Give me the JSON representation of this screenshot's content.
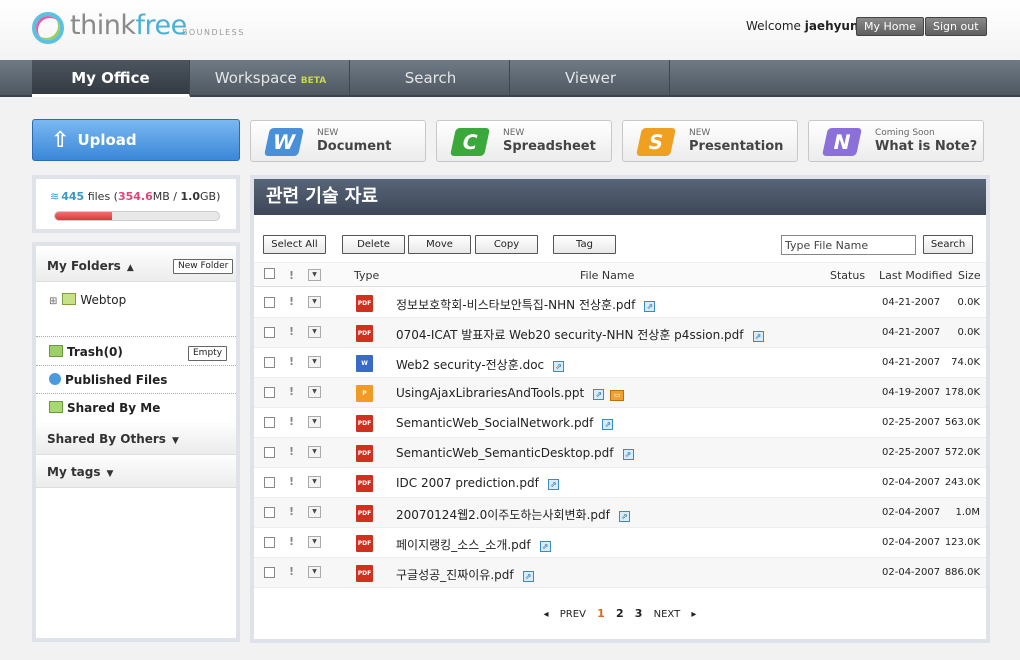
{
  "app": {
    "logo_think": "think",
    "logo_free": "free",
    "logo_tagline": "BOUNDLESS"
  },
  "header": {
    "welcome": "Welcome",
    "username": "jaehyun",
    "my_home": "My Home",
    "sign_out": "Sign out"
  },
  "nav": {
    "tabs": [
      {
        "label": "My Office",
        "active": true
      },
      {
        "label": "Workspace",
        "badge": "BETA"
      },
      {
        "label": "Search"
      },
      {
        "label": "Viewer"
      }
    ]
  },
  "actions": {
    "upload": "Upload",
    "new": [
      {
        "small": "NEW",
        "big": "Document",
        "color": "#4a90d8",
        "glyph": "W"
      },
      {
        "small": "NEW",
        "big": "Spreadsheet",
        "color": "#3aa83a",
        "glyph": "C"
      },
      {
        "small": "NEW",
        "big": "Presentation",
        "color": "#f0a020",
        "glyph": "S"
      },
      {
        "small": "Coming Soon",
        "big": "What is Note?",
        "color": "#8a70d8",
        "glyph": "N"
      }
    ]
  },
  "storage": {
    "files_count": "445",
    "files_label": "files",
    "used": "354.6",
    "used_unit": "MB",
    "total": "1.0",
    "total_unit": "GB",
    "percent_used": 35
  },
  "sidebar": {
    "my_folders": "My Folders",
    "new_folder": "New Folder",
    "webtop": "Webtop",
    "trash": "Trash(0)",
    "empty": "Empty",
    "published": "Published Files",
    "shared_by_me": "Shared By Me",
    "shared_by_others": "Shared By Others",
    "my_tags": "My tags"
  },
  "main": {
    "title": "관련 기술 자료",
    "toolbar": {
      "select_all": "Select All",
      "delete": "Delete",
      "move": "Move",
      "copy": "Copy",
      "tag": "Tag",
      "search_placeholder": "Type File Name",
      "search": "Search"
    },
    "columns": {
      "important": "!",
      "type": "Type",
      "file_name": "File Name",
      "status": "Status",
      "last_modified": "Last Modified",
      "size": "Size"
    },
    "files": [
      {
        "type": "pdf",
        "name": "정보보호학회-비스타보안특집-NHN 전상훈.pdf",
        "modified": "04-21-2007",
        "size": "0.0K"
      },
      {
        "type": "pdf",
        "name": "0704-ICAT 발표자료 Web20 security-NHN 전상훈 p4ssion.pdf",
        "modified": "04-21-2007",
        "size": "0.0K"
      },
      {
        "type": "doc",
        "name": "Web2 security-전상훈.doc",
        "modified": "04-21-2007",
        "size": "74.0K"
      },
      {
        "type": "ppt",
        "name": "UsingAjaxLibrariesAndTools.ppt",
        "modified": "04-19-2007",
        "size": "178.0K",
        "presentable": true
      },
      {
        "type": "pdf",
        "name": "SemanticWeb_SocialNetwork.pdf",
        "modified": "02-25-2007",
        "size": "563.0K"
      },
      {
        "type": "pdf",
        "name": "SemanticWeb_SemanticDesktop.pdf",
        "modified": "02-25-2007",
        "size": "572.0K"
      },
      {
        "type": "pdf",
        "name": "IDC 2007 prediction.pdf",
        "modified": "02-04-2007",
        "size": "243.0K"
      },
      {
        "type": "pdf",
        "name": "20070124웹2.0이주도하는사회변화.pdf",
        "modified": "02-04-2007",
        "size": "1.0M"
      },
      {
        "type": "pdf",
        "name": "페이지랭킹_소스_소개.pdf",
        "modified": "02-04-2007",
        "size": "123.0K"
      },
      {
        "type": "pdf",
        "name": "구글성공_진짜이유.pdf",
        "modified": "02-04-2007",
        "size": "886.0K"
      }
    ],
    "pager": {
      "prev": "PREV",
      "next": "NEXT",
      "pages": [
        "1",
        "2",
        "3"
      ],
      "current": "1"
    }
  }
}
